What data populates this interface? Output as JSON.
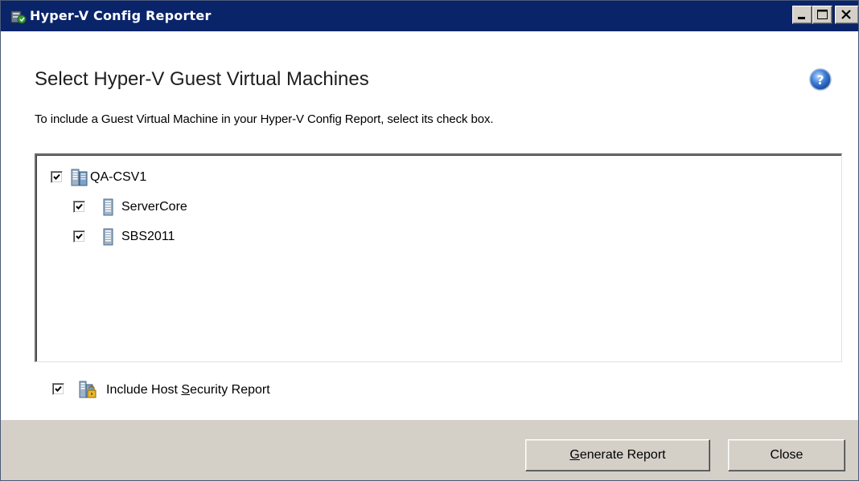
{
  "window": {
    "title": "Hyper-V Config Reporter"
  },
  "heading": "Select Hyper-V Guest Virtual Machines",
  "instruction": "To include a Guest Virtual Machine in your Hyper-V Config Report, select its check box.",
  "tree": {
    "host": {
      "label": "QA-CSV1",
      "checked": true
    },
    "guests": [
      {
        "label": "ServerCore",
        "checked": true
      },
      {
        "label": "SBS2011",
        "checked": true
      }
    ]
  },
  "host_security": {
    "label_before": "Include Host ",
    "label_accel": "S",
    "label_after": "ecurity Report",
    "checked": true
  },
  "buttons": {
    "generate_accel": "G",
    "generate_rest": "enerate Report",
    "close": "Close"
  },
  "colors": {
    "titlebar": "#0a246a",
    "dialog_bg": "#ffffff",
    "footer_bg": "#d4d0c8",
    "help_icon": "#3a7bd5"
  },
  "icons": {
    "title": "hyperv-app-icon",
    "help": "help-icon",
    "host": "server-cluster-icon",
    "guest": "server-icon",
    "security": "host-security-icon"
  }
}
